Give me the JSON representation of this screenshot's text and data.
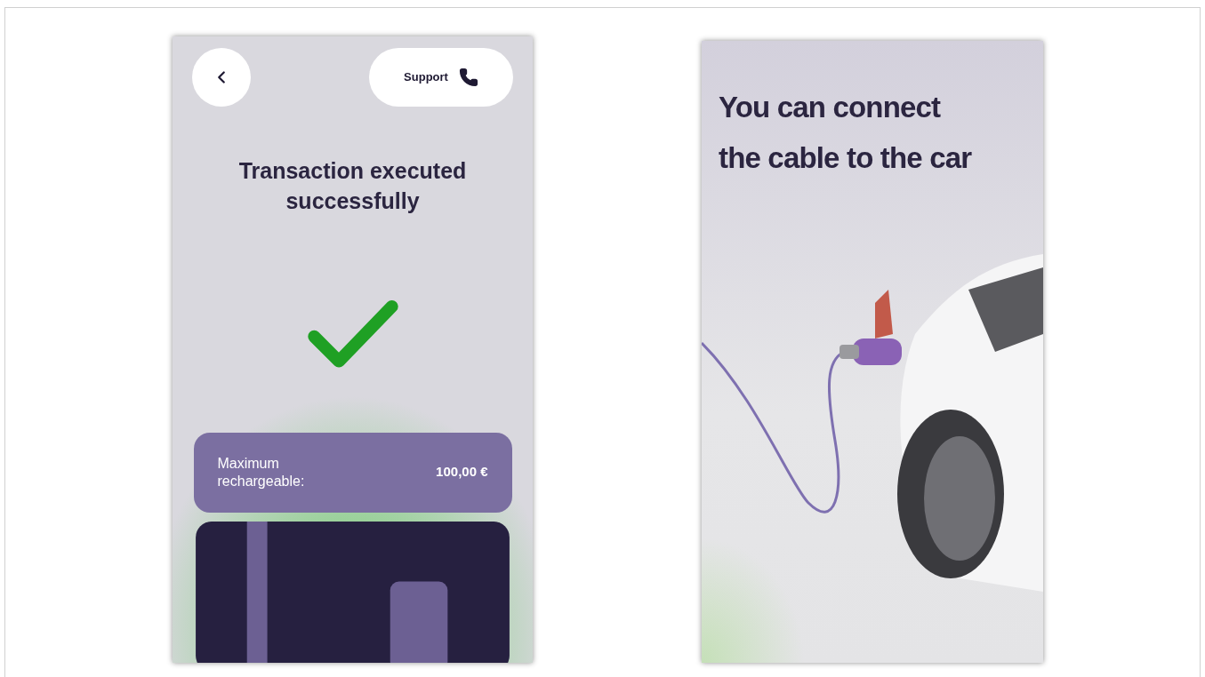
{
  "screens": [
    {
      "kind": "confirmation",
      "support_label": "Support",
      "title": "Transaction executed successfully",
      "summary": {
        "label": "Maximum rechargeable:",
        "value": "100,00 €"
      }
    },
    {
      "kind": "instruction",
      "title": "You can connect the cable to the car"
    }
  ]
}
